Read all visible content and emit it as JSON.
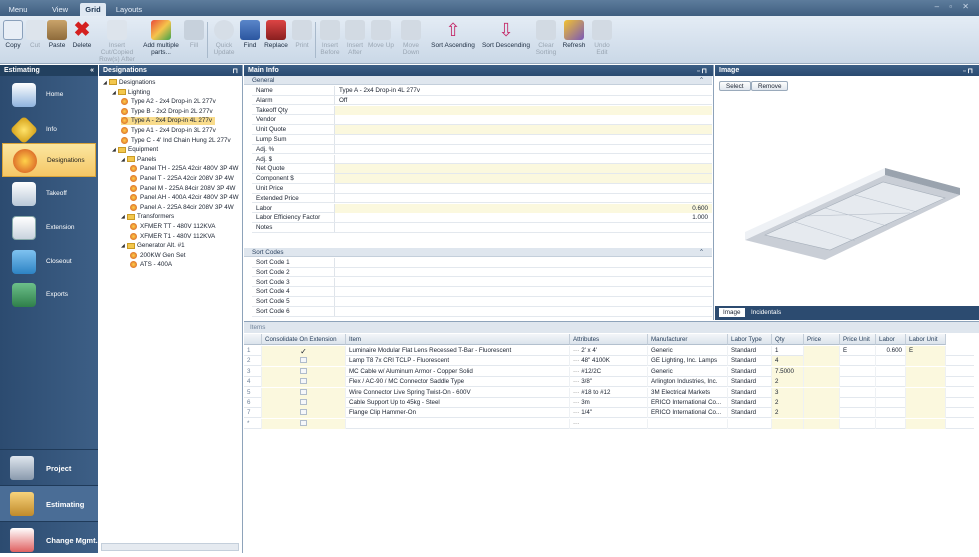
{
  "tabs": [
    "Menu",
    "View",
    "Grid",
    "Layouts"
  ],
  "active_tab": "Grid",
  "ribbon": {
    "copy": "Copy",
    "cut": "Cut",
    "paste": "Paste",
    "delete": "Delete",
    "insert_cut": "Insert Cut/Copied Row(s) After",
    "add_multiple": "Add multiple parts...",
    "fill": "Fill",
    "quick_update": "Quick Update",
    "find": "Find",
    "replace": "Replace",
    "print": "Print",
    "insert_before": "Insert Before",
    "insert_after": "Insert After",
    "move_up": "Move Up",
    "move_down": "Move Down",
    "sort_asc": "Sort Ascending",
    "sort_desc": "Sort Descending",
    "clear_sorting": "Clear Sorting",
    "refresh": "Refresh",
    "undo_edit": "Undo Edit"
  },
  "nav": {
    "header": "Estimating",
    "collapse": "«",
    "items": [
      "Home",
      "Info",
      "Designations",
      "Takeoff",
      "Extension",
      "Closeout",
      "Exports"
    ],
    "selected": "Designations",
    "bottom": [
      "Project",
      "Estimating",
      "Change Mgmt."
    ]
  },
  "designations": {
    "header": "Designations",
    "pin": "⊓",
    "tree": [
      {
        "label": "Designations",
        "level": 0,
        "kind": "folder"
      },
      {
        "label": "Lighting",
        "level": 1,
        "kind": "folder"
      },
      {
        "label": "Type A2 - 2x4 Drop-in 2L 277v",
        "level": 2,
        "kind": "item"
      },
      {
        "label": "Type B - 2x2 Drop-in 2L 277v",
        "level": 2,
        "kind": "item"
      },
      {
        "label": "Type A - 2x4 Drop-in 4L 277v",
        "level": 2,
        "kind": "item",
        "selected": true
      },
      {
        "label": "Type A1 - 2x4 Drop-in 3L 277v",
        "level": 2,
        "kind": "item"
      },
      {
        "label": "Type C - 4' Ind Chain Hung 2L 277v",
        "level": 2,
        "kind": "item"
      },
      {
        "label": "Equipment",
        "level": 1,
        "kind": "folder"
      },
      {
        "label": "Panels",
        "level": 2,
        "kind": "folder"
      },
      {
        "label": "Panel TH - 225A 42cir 480V 3P 4W",
        "level": 3,
        "kind": "item"
      },
      {
        "label": "Panel T - 225A 42cir 208V 3P 4W",
        "level": 3,
        "kind": "item"
      },
      {
        "label": "Panel M - 225A 84cir 208V 3P 4W",
        "level": 3,
        "kind": "item"
      },
      {
        "label": "Panel AH - 400A 42cir 480V 3P 4W",
        "level": 3,
        "kind": "item"
      },
      {
        "label": "Panel A - 225A 84cir 208V 3P 4W",
        "level": 3,
        "kind": "item"
      },
      {
        "label": "Transformers",
        "level": 2,
        "kind": "folder"
      },
      {
        "label": "XFMER TT - 480V 112KVA",
        "level": 3,
        "kind": "item"
      },
      {
        "label": "XFMER T1 - 480V 112KVA",
        "level": 3,
        "kind": "item"
      },
      {
        "label": "Generator Alt. #1",
        "level": 2,
        "kind": "folder"
      },
      {
        "label": "200KW Gen Set",
        "level": 3,
        "kind": "item"
      },
      {
        "label": "ATS - 400A",
        "level": 3,
        "kind": "item"
      }
    ]
  },
  "main_info": {
    "header": "Main Info",
    "section_general": "General",
    "section_sort": "Sort Codes",
    "general": [
      {
        "k": "Name",
        "v": "Type A - 2x4 Drop-in 4L 277v"
      },
      {
        "k": "Alarm",
        "v": "Off"
      },
      {
        "k": "Takeoff Qty",
        "v": ""
      },
      {
        "k": "Vendor",
        "v": ""
      },
      {
        "k": "Unit Quote",
        "v": ""
      },
      {
        "k": "Lump Sum",
        "v": ""
      },
      {
        "k": "Adj. %",
        "v": ""
      },
      {
        "k": "Adj. $",
        "v": ""
      },
      {
        "k": "Net Quote",
        "v": ""
      },
      {
        "k": "Component $",
        "v": ""
      },
      {
        "k": "Unit Price",
        "v": ""
      },
      {
        "k": "Extended Price",
        "v": ""
      },
      {
        "k": "Labor",
        "v": "0.600"
      },
      {
        "k": "Labor Efficiency Factor",
        "v": "1.000"
      },
      {
        "k": "Notes",
        "v": ""
      }
    ],
    "sort_codes": [
      "Sort Code 1",
      "Sort Code 2",
      "Sort Code 3",
      "Sort Code 4",
      "Sort Code 5",
      "Sort Code 6"
    ]
  },
  "image_panel": {
    "header": "Image",
    "select": "Select",
    "remove": "Remove",
    "tabs": [
      "Image",
      "Incidentals"
    ]
  },
  "items": {
    "header": "Items",
    "columns": [
      "Consolidate On Extension",
      "Item",
      "Attributes",
      "Manufacturer",
      "Labor Type",
      "Qty",
      "Price",
      "Price Unit",
      "Labor",
      "Labor Unit"
    ],
    "rows": [
      {
        "n": "1",
        "chk": "✓",
        "item": "Luminaire Modular Flat Lens Recessed T-Bar - Fluorescent",
        "attr": "2' x 4'",
        "mfr": "Generic",
        "lt": "Standard",
        "qty": "1",
        "price": "",
        "pu": "E",
        "labor": "0.600",
        "lu": "E"
      },
      {
        "n": "2",
        "chk": "",
        "item": "Lamp T8 7x CRI TCLP - Fluorescent",
        "attr": "48\" 4100K",
        "mfr": "GE Lighting, Inc. Lamps",
        "lt": "Standard",
        "qty": "4",
        "price": "",
        "pu": "",
        "labor": "",
        "lu": ""
      },
      {
        "n": "3",
        "chk": "",
        "item": "MC Cable w/ Aluminum Armor - Copper Solid",
        "attr": "#12/2C",
        "mfr": "Generic",
        "lt": "Standard",
        "qty": "7.5000",
        "price": "",
        "pu": "",
        "labor": "",
        "lu": ""
      },
      {
        "n": "4",
        "chk": "",
        "item": "Flex / AC-90 / MC Connector Saddle Type",
        "attr": "3/8\"",
        "mfr": "Arlington Industries, Inc.",
        "lt": "Standard",
        "qty": "2",
        "price": "",
        "pu": "",
        "labor": "",
        "lu": ""
      },
      {
        "n": "5",
        "chk": "",
        "item": "Wire Connector Live Spring Twist-On - 600V",
        "attr": "#18 to #12",
        "mfr": "3M Electrical Markets",
        "lt": "Standard",
        "qty": "3",
        "price": "",
        "pu": "",
        "labor": "",
        "lu": ""
      },
      {
        "n": "6",
        "chk": "",
        "item": "Cable Support Up to 45kg - Steel",
        "attr": "3m",
        "mfr": "ERICO International Co...",
        "lt": "Standard",
        "qty": "2",
        "price": "",
        "pu": "",
        "labor": "",
        "lu": ""
      },
      {
        "n": "7",
        "chk": "",
        "item": "Flange Clip Hammer-On",
        "attr": "1/4\"",
        "mfr": "ERICO International Co...",
        "lt": "Standard",
        "qty": "2",
        "price": "",
        "pu": "",
        "labor": "",
        "lu": ""
      },
      {
        "n": "*",
        "chk": "",
        "item": "",
        "attr": "",
        "mfr": "",
        "lt": "",
        "qty": "",
        "price": "",
        "pu": "",
        "labor": "",
        "lu": ""
      }
    ]
  }
}
